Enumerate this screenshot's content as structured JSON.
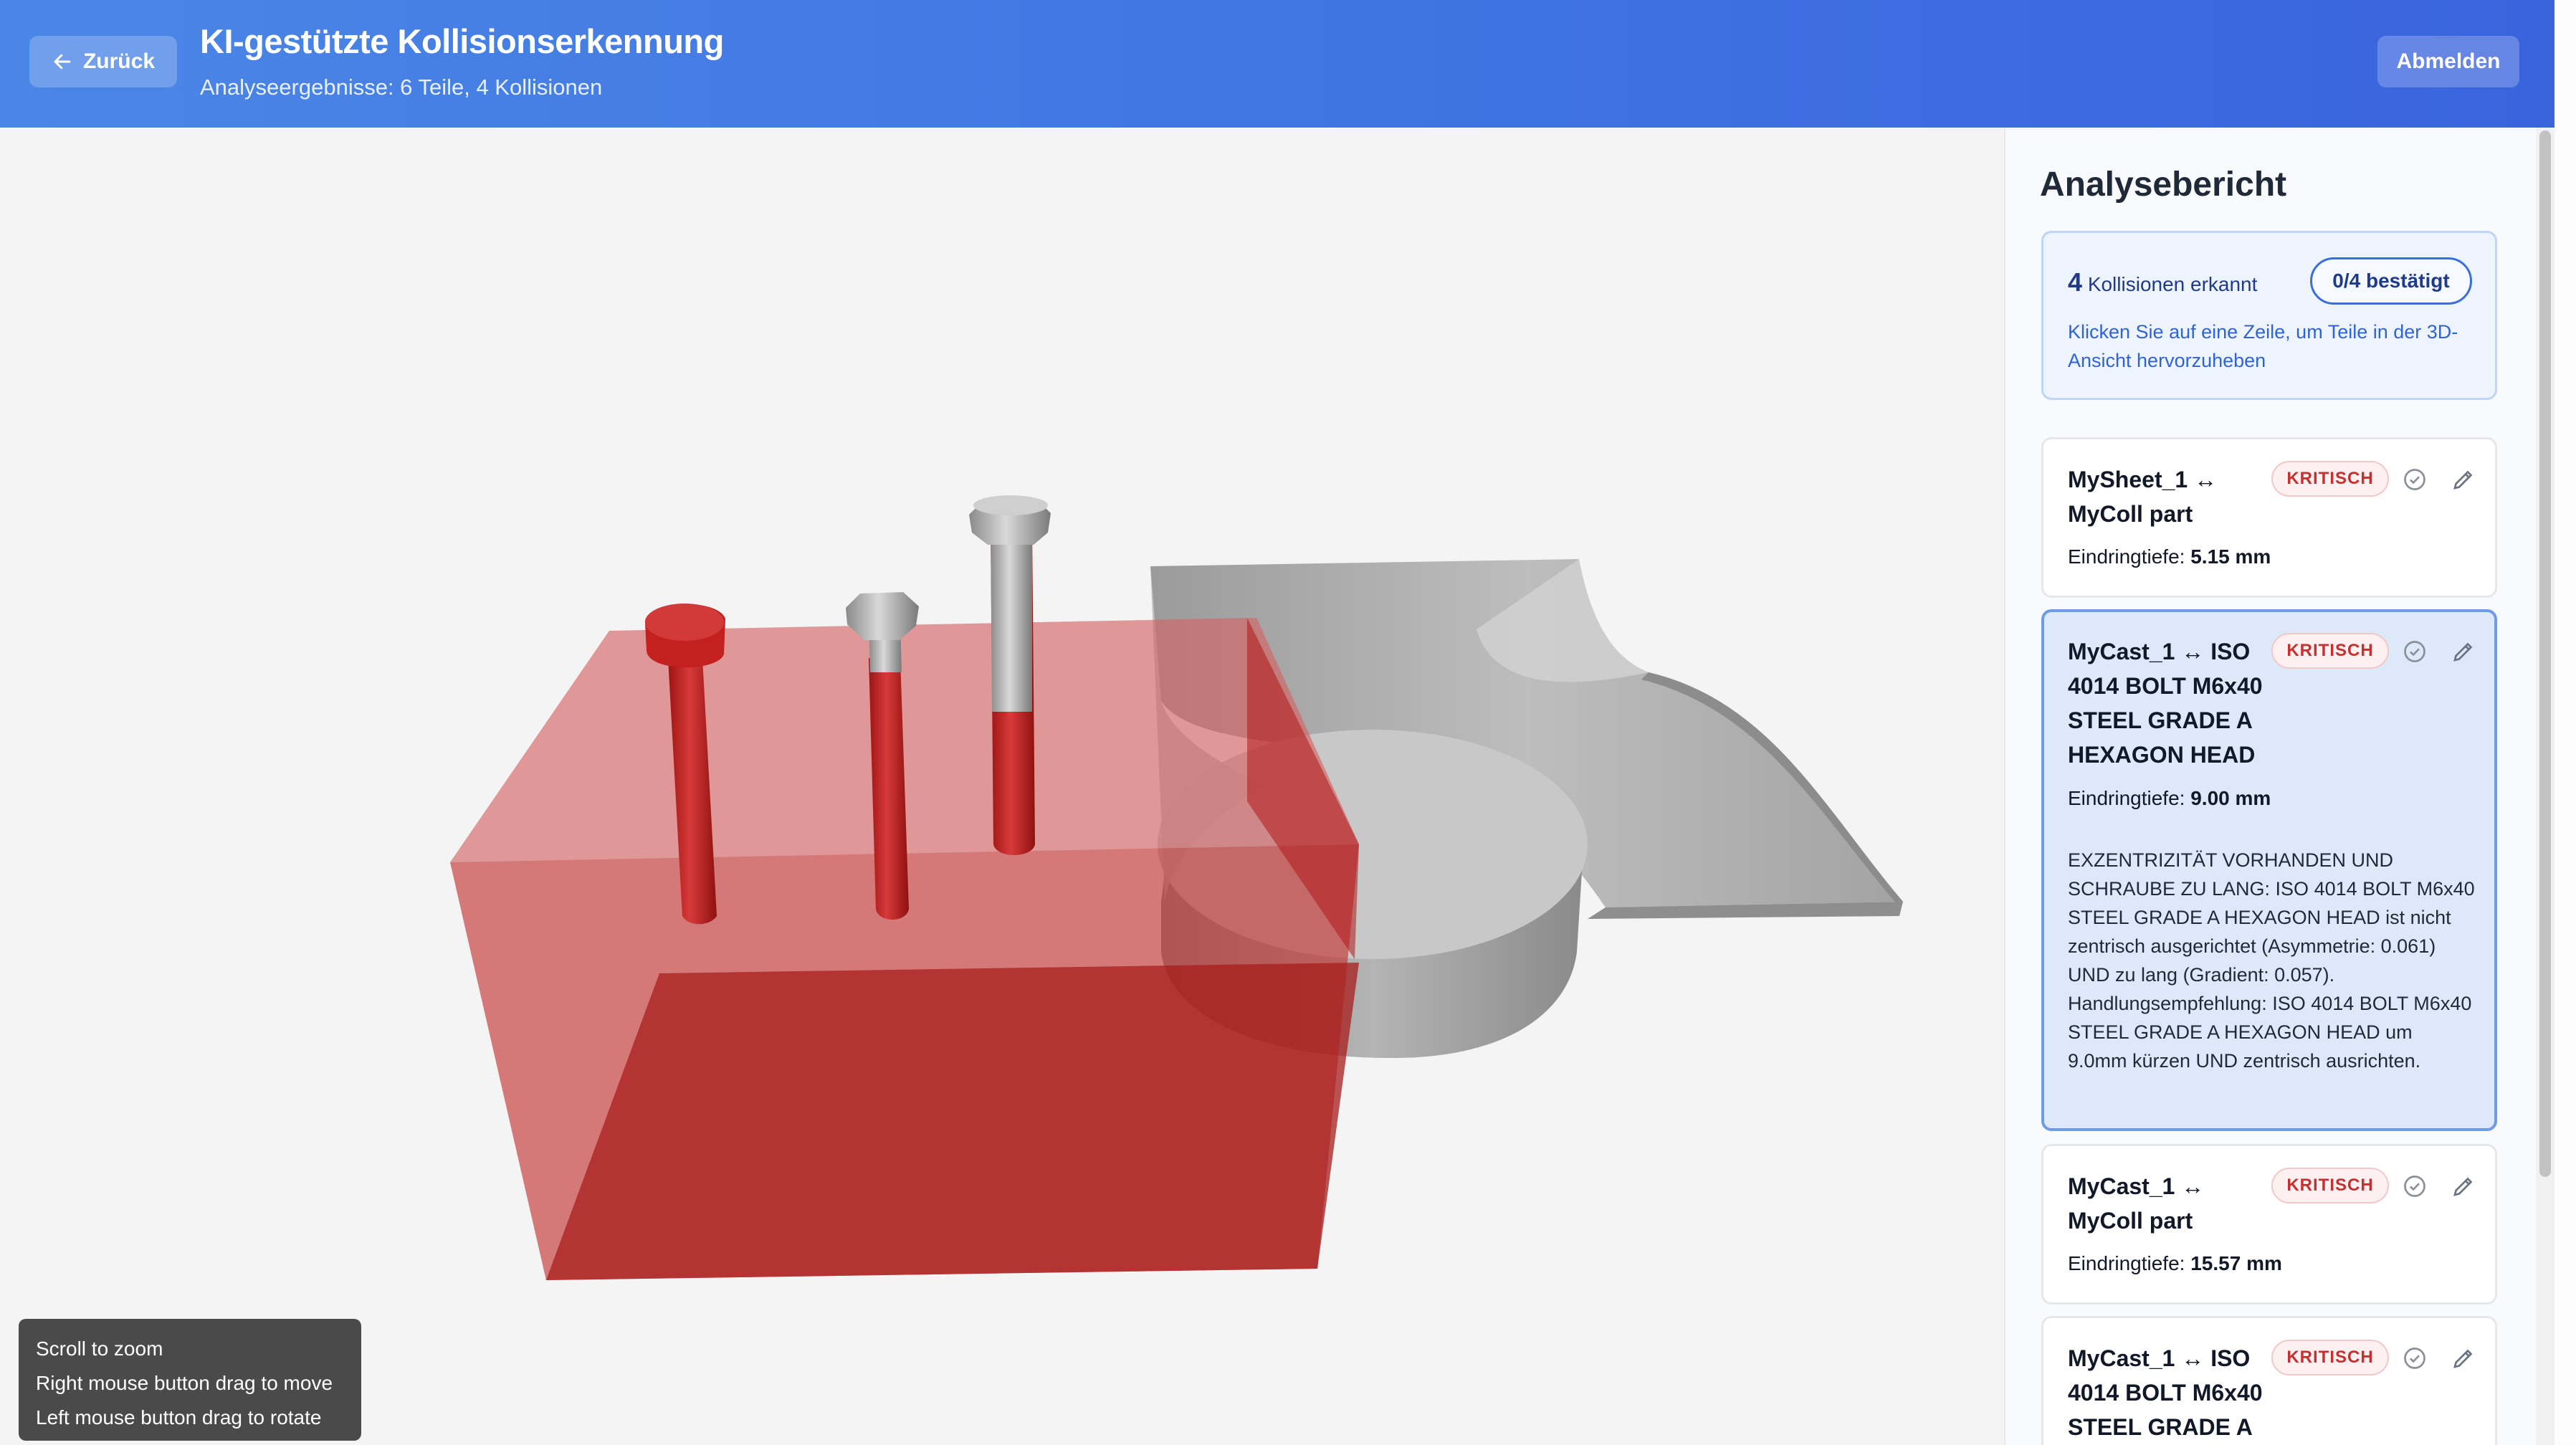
{
  "header": {
    "back_label": "Zurück",
    "title": "KI-gestützte Kollisionserkennung",
    "subtitle": "Analyseergebnisse: 6 Teile, 4 Kollisionen",
    "logout_label": "Abmelden"
  },
  "viewport": {
    "help": [
      "Scroll to zoom",
      "Right mouse button drag to move",
      "Left mouse button drag to rotate"
    ],
    "colors": {
      "collision": "#c81e1e",
      "neutral": "#a9a9a9",
      "background": "#f4f4f4"
    }
  },
  "sidebar": {
    "title": "Analysebericht",
    "summary": {
      "count": "4",
      "count_label": "Kollisionen erkannt",
      "confirmed": "0/4 bestätigt",
      "hint": "Klicken Sie auf eine Zeile, um Teile in der 3D-Ansicht hervorzuheben"
    },
    "depth_label": "Eindringtiefe:",
    "collisions": [
      {
        "title": "MySheet_1 ↔ MyColl part",
        "severity": "KRITISCH",
        "depth": "5.15 mm"
      },
      {
        "title": "MyCast_1 ↔ ISO 4014 BOLT M6x40 STEEL GRADE A HEXAGON HEAD",
        "severity": "KRITISCH",
        "depth": "9.00 mm",
        "description": "EXZENTRIZITÄT VORHANDEN UND SCHRAUBE ZU LANG: ISO 4014 BOLT M6x40 STEEL GRADE A HEXAGON HEAD ist nicht zentrisch ausgerichtet (Asymmetrie: 0.061) UND zu lang (Gradient: 0.057). Handlungsempfehlung: ISO 4014 BOLT M6x40 STEEL GRADE A HEXAGON HEAD um 9.0mm kürzen UND zentrisch ausrichten."
      },
      {
        "title": "MyCast_1 ↔ MyColl part",
        "severity": "KRITISCH",
        "depth": "15.57 mm"
      },
      {
        "title": "MyCast_1 ↔ ISO 4014 BOLT M6x40 STEEL GRADE A",
        "severity": "KRITISCH"
      }
    ]
  }
}
